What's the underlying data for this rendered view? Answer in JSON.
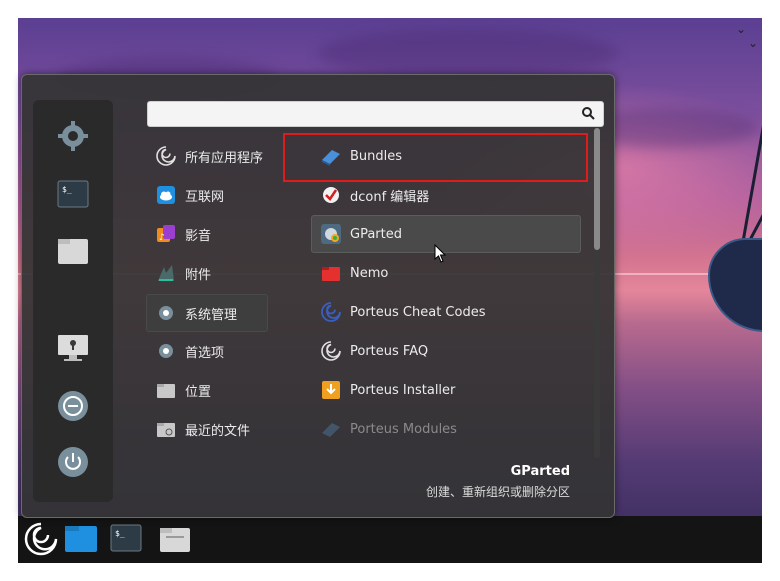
{
  "search": {
    "value": "",
    "placeholder": ""
  },
  "categories": [
    {
      "label": "所有应用程序",
      "icon": "porteus-swirl-icon"
    },
    {
      "label": "互联网",
      "icon": "cloud-icon"
    },
    {
      "label": "影音",
      "icon": "media-icon"
    },
    {
      "label": "附件",
      "icon": "accessories-icon"
    },
    {
      "label": "系统管理",
      "icon": "system-gear-icon",
      "active": true
    },
    {
      "label": "首选项",
      "icon": "preferences-gear-icon"
    },
    {
      "label": "位置",
      "icon": "folder-icon"
    },
    {
      "label": "最近的文件",
      "icon": "recent-folder-icon"
    }
  ],
  "apps": [
    {
      "label": "Bundles",
      "icon": "bundles-icon"
    },
    {
      "label": "dconf 编辑器",
      "icon": "dconf-icon"
    },
    {
      "label": "GParted",
      "icon": "gparted-icon",
      "hover": true
    },
    {
      "label": "Nemo",
      "icon": "nemo-folder-icon"
    },
    {
      "label": "Porteus Cheat Codes",
      "icon": "porteus-swirl-icon"
    },
    {
      "label": "Porteus FAQ",
      "icon": "porteus-swirl-icon"
    },
    {
      "label": "Porteus Installer",
      "icon": "installer-icon"
    },
    {
      "label": "Porteus Modules",
      "icon": "modules-icon",
      "dim": true
    }
  ],
  "description": {
    "title": "GParted",
    "text": "创建、重新组织或删除分区"
  },
  "sidebar": [
    "settings-icon",
    "terminal-icon",
    "files-icon",
    "lock-screen-icon",
    "logout-icon",
    "power-icon"
  ],
  "taskbar": [
    "porteus-menu-icon",
    "folder-blue-icon",
    "terminal-icon",
    "file-manager-icon"
  ],
  "colors": {
    "highlight": "#e01b1b",
    "menu_bg": "#343434"
  }
}
